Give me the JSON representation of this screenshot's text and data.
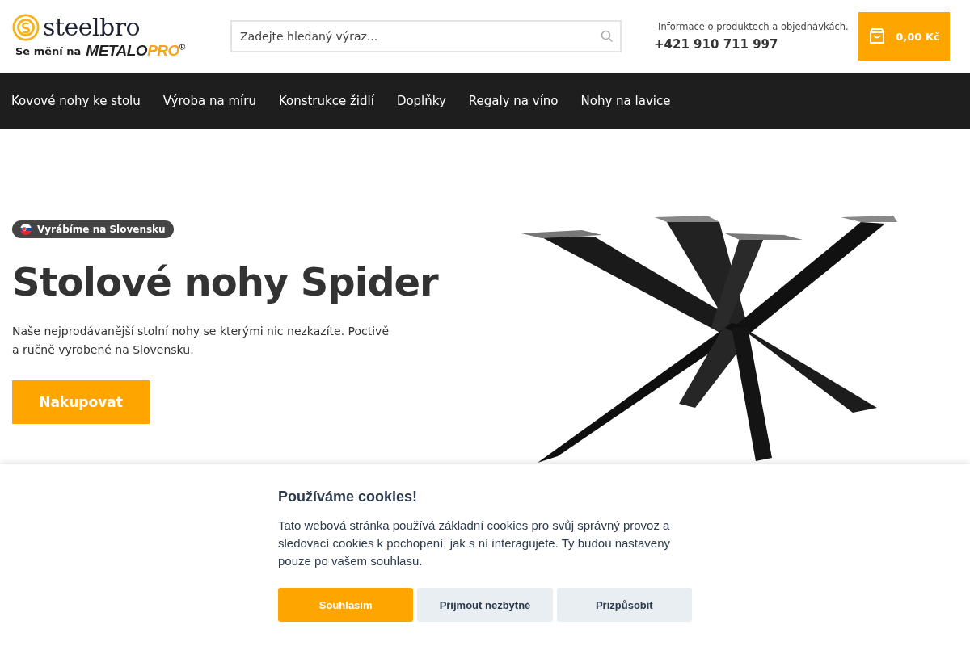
{
  "header": {
    "logo": {
      "name": "steelbro",
      "tagline": "Se mění na",
      "brand_left": "METALO",
      "brand_right": "PRO",
      "registered": "®"
    },
    "search": {
      "placeholder": "Zadejte hledaný výraz..."
    },
    "contact": {
      "info": "Informace o produktech a objednávkách.",
      "phone": "+421 910 711 997"
    },
    "cart": {
      "total": "0,00 Kč"
    }
  },
  "nav": {
    "items": [
      {
        "label": "Kovové nohy ke stolu"
      },
      {
        "label": "Výroba na míru"
      },
      {
        "label": "Konstrukce židlí"
      },
      {
        "label": "Doplňky"
      },
      {
        "label": "Regaly na víno"
      },
      {
        "label": "Nohy na lavice"
      }
    ]
  },
  "hero": {
    "badge": "Vyrábíme na Slovensku",
    "title": "Stolové nohy Spider",
    "text": "Naše nejprodávanější stolní nohy se kterými nic nezkazíte. Poctivě a ručně vyrobené na Slovensku.",
    "button": "Nakupovat"
  },
  "cookies": {
    "title": "Používáme cookies!",
    "text": "Tato webová stránka používá základní cookies pro svůj správný provoz a sledovací cookies k pochopení, jak s ní interagujete. Ty budou nastaveny pouze po vašem souhlasu.",
    "buttons": [
      {
        "label": "Souhlasím",
        "kind": "primary"
      },
      {
        "label": "Přijmout nezbytné",
        "kind": "secondary"
      },
      {
        "label": "Přizpůsobit",
        "kind": "secondary"
      }
    ]
  }
}
